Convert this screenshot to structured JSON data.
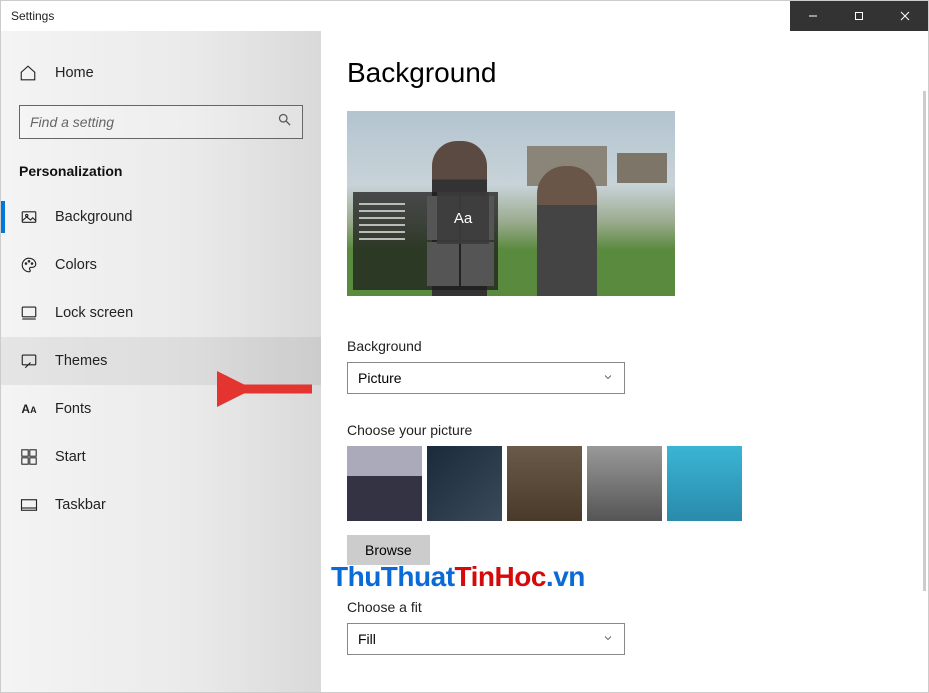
{
  "window": {
    "title": "Settings"
  },
  "sidebar": {
    "home": "Home",
    "search_placeholder": "Find a setting",
    "section": "Personalization",
    "items": [
      {
        "label": "Background",
        "active": true,
        "highlight": false,
        "icon": "image"
      },
      {
        "label": "Colors",
        "active": false,
        "highlight": false,
        "icon": "palette"
      },
      {
        "label": "Lock screen",
        "active": false,
        "highlight": false,
        "icon": "lock"
      },
      {
        "label": "Themes",
        "active": false,
        "highlight": true,
        "icon": "brush"
      },
      {
        "label": "Fonts",
        "active": false,
        "highlight": false,
        "icon": "font"
      },
      {
        "label": "Start",
        "active": false,
        "highlight": false,
        "icon": "start"
      },
      {
        "label": "Taskbar",
        "active": false,
        "highlight": false,
        "icon": "taskbar"
      }
    ]
  },
  "main": {
    "heading": "Background",
    "preview_sample_text": "Aa",
    "background_label": "Background",
    "background_value": "Picture",
    "choose_picture_label": "Choose your picture",
    "browse_label": "Browse",
    "choose_fit_label": "Choose a fit",
    "choose_fit_value": "Fill"
  },
  "watermark": {
    "part1": "ThuThuat",
    "part2": "TinHoc",
    "part3": ".vn"
  },
  "annotation": {
    "arrow_color": "#E3342F"
  }
}
